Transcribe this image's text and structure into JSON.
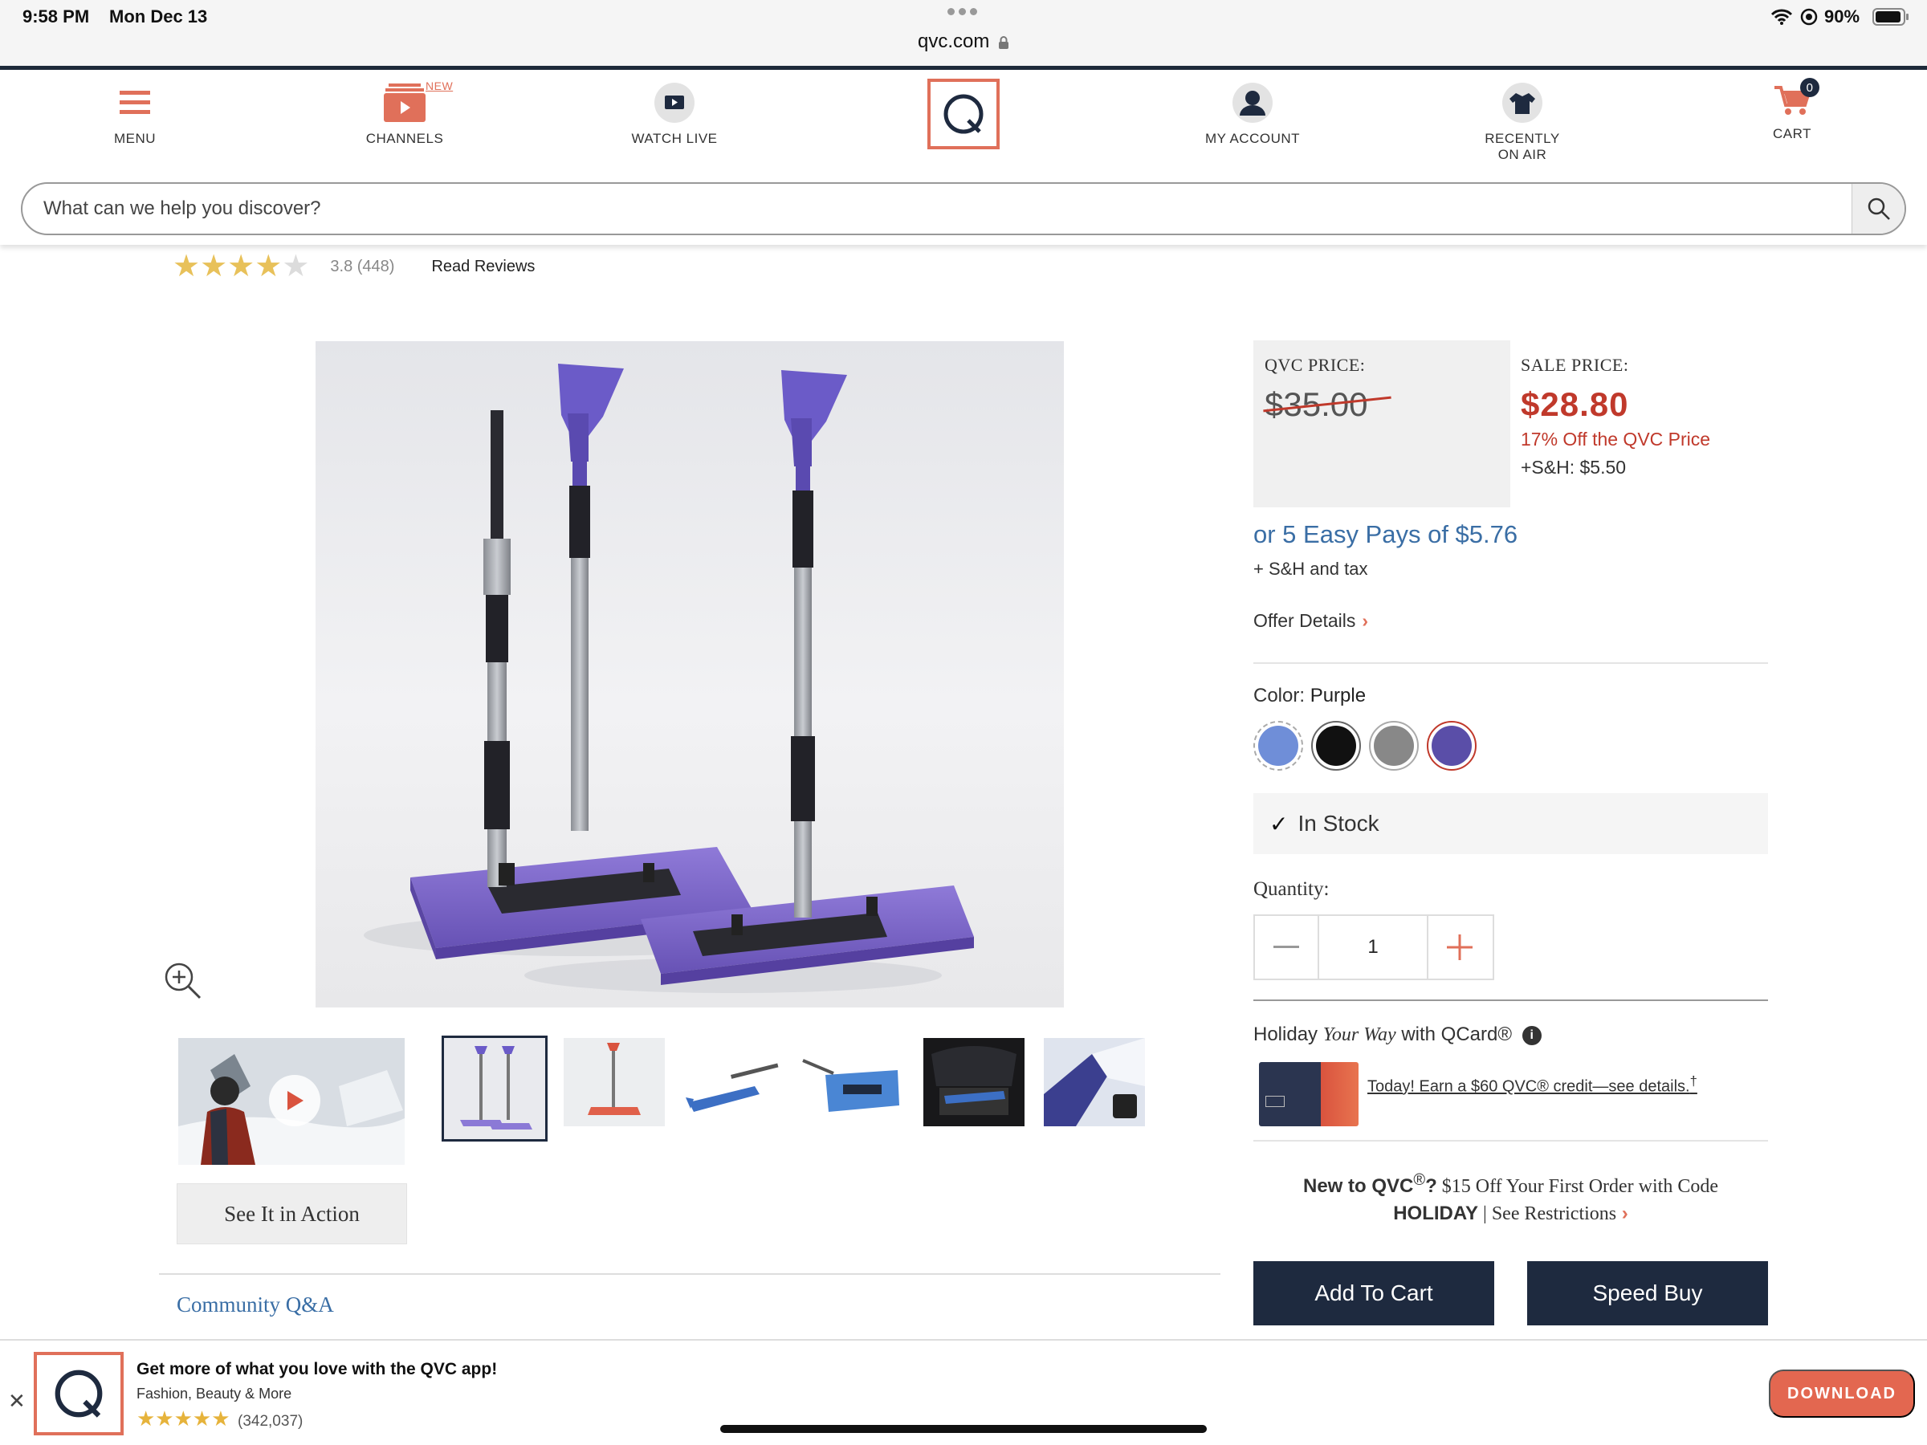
{
  "status_bar": {
    "time": "9:58 PM",
    "date": "Mon Dec 13",
    "battery": "90%",
    "url": "qvc.com"
  },
  "nav": {
    "menu": "MENU",
    "channels": "CHANNELS",
    "channels_badge": "NEW",
    "watch_live": "WATCH LIVE",
    "my_account": "MY ACCOUNT",
    "recently_line1": "RECENTLY",
    "recently_line2": "ON AIR",
    "cart": "CART",
    "cart_count": "0"
  },
  "search": {
    "placeholder": "What can we help you discover?"
  },
  "rating": {
    "value": 3.8,
    "count_text": "3.8 (448)",
    "stars_filled": 4,
    "stars_total": 5,
    "read_reviews": "Read Reviews"
  },
  "gallery": {
    "see_it_in_action": "See It in Action",
    "thumbnail_count": 6,
    "selected_thumbnail": 1
  },
  "community": {
    "qna": "Community Q&A"
  },
  "price": {
    "qvc_label": "QVC PRICE:",
    "qvc_price": "$35.00",
    "sale_label": "SALE PRICE:",
    "sale_price": "$28.80",
    "discount": "17% Off the QVC Price",
    "sh": "+S&H: $5.50",
    "easy_pay": "or 5 Easy Pays of $5.76",
    "sh_tax": "+ S&H and tax",
    "offer_details": "Offer Details"
  },
  "color": {
    "label": "Color:",
    "selected": "Purple",
    "swatches": [
      "#6f8ed8",
      "#111111",
      "#888888",
      "#5a4ea8"
    ],
    "selected_index": 3
  },
  "stock": {
    "text": "In Stock"
  },
  "quantity": {
    "label": "Quantity:",
    "value": "1"
  },
  "qcard": {
    "prefix": "Holiday ",
    "italic": "Your Way",
    "suffix": " with QCard®",
    "link": "Today! Earn a $60 QVC® credit—see details.",
    "dagger": "†"
  },
  "promo": {
    "new_to": "New to QVC",
    "reg": "®",
    "q": "?",
    "offer": " $15 Off Your First Order with Code",
    "code": "HOLIDAY",
    "sep": " | ",
    "restrictions": "See Restrictions"
  },
  "buttons": {
    "add_to_cart": "Add To Cart",
    "speed_buy": "Speed Buy"
  },
  "app_banner": {
    "title": "Get more of what you love with the QVC app!",
    "subtitle": "Fashion, Beauty & More",
    "stars": "★★★★★",
    "count": "(342,037)",
    "download": "DOWNLOAD"
  },
  "colors": {
    "accent": "#e0705a",
    "sale_red": "#c0392b",
    "link_blue": "#3a6ea5",
    "button_navy": "#1e2a3f"
  }
}
